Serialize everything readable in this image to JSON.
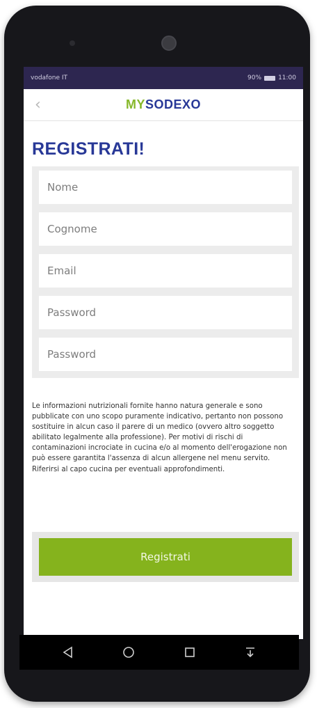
{
  "status_bar": {
    "carrier": "vodafone IT",
    "battery": "90%",
    "time": "11:00"
  },
  "app": {
    "logo_my": "MY",
    "logo_rest": "SODEXO",
    "page_title": "REGISTRATI!"
  },
  "form": {
    "fields": [
      {
        "placeholder": "Nome"
      },
      {
        "placeholder": "Cognome"
      },
      {
        "placeholder": "Email"
      },
      {
        "placeholder": "Password"
      },
      {
        "placeholder": "Password"
      }
    ]
  },
  "disclaimer": "Le informazioni nutrizionali fornite hanno natura generale e sono pubblicate con uno scopo puramente indicativo, pertanto non possono sostituire in alcun caso il parere di un medico (ovvero altro soggetto abilitato legalmente alla professione). Per motivi di rischi di contaminazioni incrociate in cucina e/o al momento dell'erogazione non può essere garantita l'assenza di alcun allergene nel menu servito. Riferirsi al capo cucina per eventuali approfondimenti.",
  "register_button": "Registrati",
  "colors": {
    "brand_blue": "#283897",
    "brand_green": "#86b82a",
    "status_bar": "#2d2650"
  },
  "icons": [
    "back-icon",
    "nav-back-icon",
    "nav-home-icon",
    "nav-recents-icon",
    "nav-notifications-icon"
  ]
}
